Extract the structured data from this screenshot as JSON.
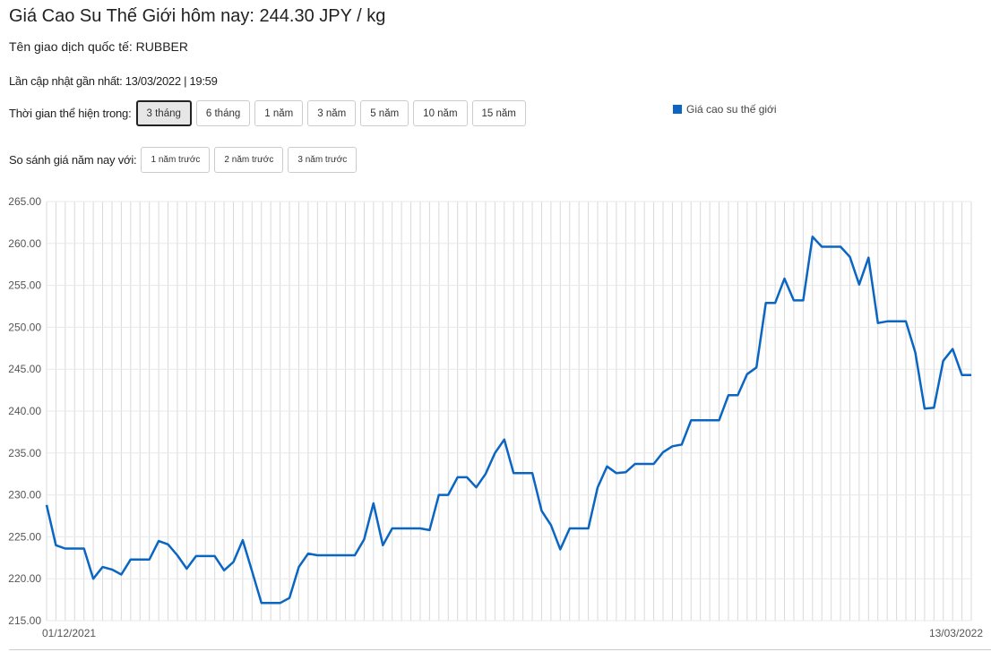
{
  "header": {
    "title": "Giá Cao Su Thế Giới hôm nay: 244.30 JPY / kg",
    "trade_name": "Tên giao dịch quốc tế: RUBBER",
    "updated": "Lần cập nhật gần nhất: 13/03/2022 | 19:59"
  },
  "period": {
    "label": "Thời gian thể hiện trong:",
    "options": [
      "3 tháng",
      "6 tháng",
      "1 năm",
      "3 năm",
      "5 năm",
      "10 năm",
      "15 năm"
    ],
    "selected": "3 tháng"
  },
  "compare": {
    "label": "So sánh giá năm nay với:",
    "options": [
      "1 năm trước",
      "2 năm trước",
      "3 năm trước"
    ]
  },
  "chart_data": {
    "type": "line",
    "ylim": [
      215,
      265
    ],
    "yticks": [
      "215.00",
      "220.00",
      "225.00",
      "230.00",
      "235.00",
      "240.00",
      "245.00",
      "250.00",
      "255.00",
      "260.00",
      "265.00"
    ],
    "x_start_label": "01/12/2021",
    "x_end_label": "13/03/2022",
    "grid": true,
    "legend_position": "top-right",
    "series": [
      {
        "name": "Giá cao su thế giới",
        "color": "#0a66c2",
        "values": [
          228.8,
          224.0,
          223.6,
          223.6,
          223.6,
          220.0,
          221.4,
          221.1,
          220.5,
          222.3,
          222.3,
          222.3,
          224.5,
          224.1,
          222.8,
          221.2,
          222.7,
          222.7,
          222.7,
          221.0,
          222.0,
          224.6,
          220.9,
          217.1,
          217.1,
          217.1,
          217.7,
          221.4,
          223.0,
          222.8,
          222.8,
          222.8,
          222.8,
          222.8,
          224.7,
          229.0,
          224.0,
          226.0,
          226.0,
          226.0,
          226.0,
          225.8,
          230.0,
          230.0,
          232.1,
          232.1,
          230.9,
          232.5,
          235.0,
          236.6,
          232.6,
          232.6,
          232.6,
          228.1,
          226.4,
          223.5,
          226.0,
          226.0,
          226.0,
          230.9,
          233.4,
          232.6,
          232.7,
          233.7,
          233.7,
          233.7,
          235.1,
          235.8,
          236.0,
          238.9,
          238.9,
          238.9,
          238.9,
          241.9,
          241.9,
          244.4,
          245.2,
          252.9,
          252.9,
          255.8,
          253.2,
          253.2,
          260.8,
          259.6,
          259.6,
          259.6,
          258.4,
          255.1,
          258.3,
          250.5,
          250.7,
          250.7,
          250.7,
          247.0,
          240.3,
          240.4,
          246.0,
          247.4,
          244.3,
          244.3
        ]
      }
    ]
  }
}
